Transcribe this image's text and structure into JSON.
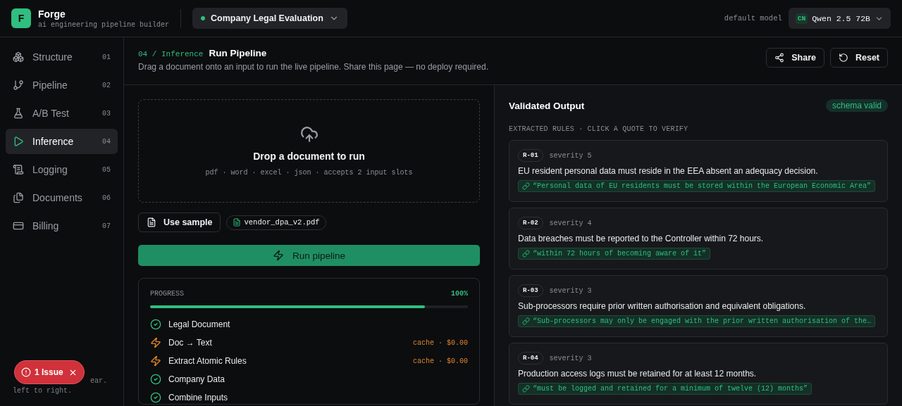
{
  "brand": {
    "logo": "F",
    "name": "Forge",
    "tagline": "ai engineering pipeline builder"
  },
  "project": {
    "name": "Company Legal Evaluation"
  },
  "model": {
    "label": "default model",
    "badge": "CN",
    "name": "Qwen 2.5 72B"
  },
  "sidebar": {
    "items": [
      {
        "label": "Structure",
        "number": "01",
        "selected": false
      },
      {
        "label": "Pipeline",
        "number": "02",
        "selected": false
      },
      {
        "label": "A/B Test",
        "number": "03",
        "selected": false
      },
      {
        "label": "Inference",
        "number": "04",
        "selected": true
      },
      {
        "label": "Logging",
        "number": "05",
        "selected": false
      },
      {
        "label": "Documents",
        "number": "06",
        "selected": false
      },
      {
        "label": "Billing",
        "number": "07",
        "selected": false
      }
    ],
    "hint": [
      "ear.",
      "left to right."
    ]
  },
  "page": {
    "crumb": "04 / Inference",
    "title": "Run Pipeline",
    "subtitle": "Drag a document onto an input to run the live pipeline. Share this page — no deploy required.",
    "actions": [
      "Share",
      "Reset"
    ]
  },
  "dropzone": {
    "title": "Drop a document to run",
    "formats": "pdf · word · excel · json · accepts 2 input slots"
  },
  "sample_button": "Use sample",
  "file_chip": "vendor_dpa_v2.pdf",
  "run_button": "Run pipeline",
  "progress": {
    "label": "PROGRESS",
    "percent": "100%",
    "level": 0.865,
    "steps": [
      {
        "kind": "done",
        "label": "Legal Document"
      },
      {
        "kind": "cached",
        "label": "Doc → Text",
        "note": "cache · $0.00"
      },
      {
        "kind": "cached",
        "label": "Extract Atomic Rules",
        "note": "cache · $0.00"
      },
      {
        "kind": "done",
        "label": "Company Data"
      },
      {
        "kind": "done",
        "label": "Combine Inputs"
      }
    ]
  },
  "output": {
    "title": "Validated Output",
    "status": "schema valid",
    "section": "EXTRACTED RULES · CLICK A QUOTE TO VERIFY",
    "rules": [
      {
        "id": "R-01",
        "severity": "severity 5",
        "text": "EU resident personal data must reside in the EEA absent an adequacy decision.",
        "quote": "“Personal data of EU residents must be stored within the European Economic Area”"
      },
      {
        "id": "R-02",
        "severity": "severity 4",
        "text": "Data breaches must be reported to the Controller within 72 hours.",
        "quote": "“within 72 hours of becoming aware of it”"
      },
      {
        "id": "R-03",
        "severity": "severity 3",
        "text": "Sub-processors require prior written authorisation and equivalent obligations.",
        "quote": "“Sub-processors may only be engaged with the prior written authorisation of the…"
      },
      {
        "id": "R-04",
        "severity": "severity 3",
        "text": "Production access logs must be retained for at least 12 months.",
        "quote": "“must be logged and retained for a minimum of twelve (12) months”"
      }
    ]
  },
  "toast": {
    "label": "1 Issue"
  }
}
